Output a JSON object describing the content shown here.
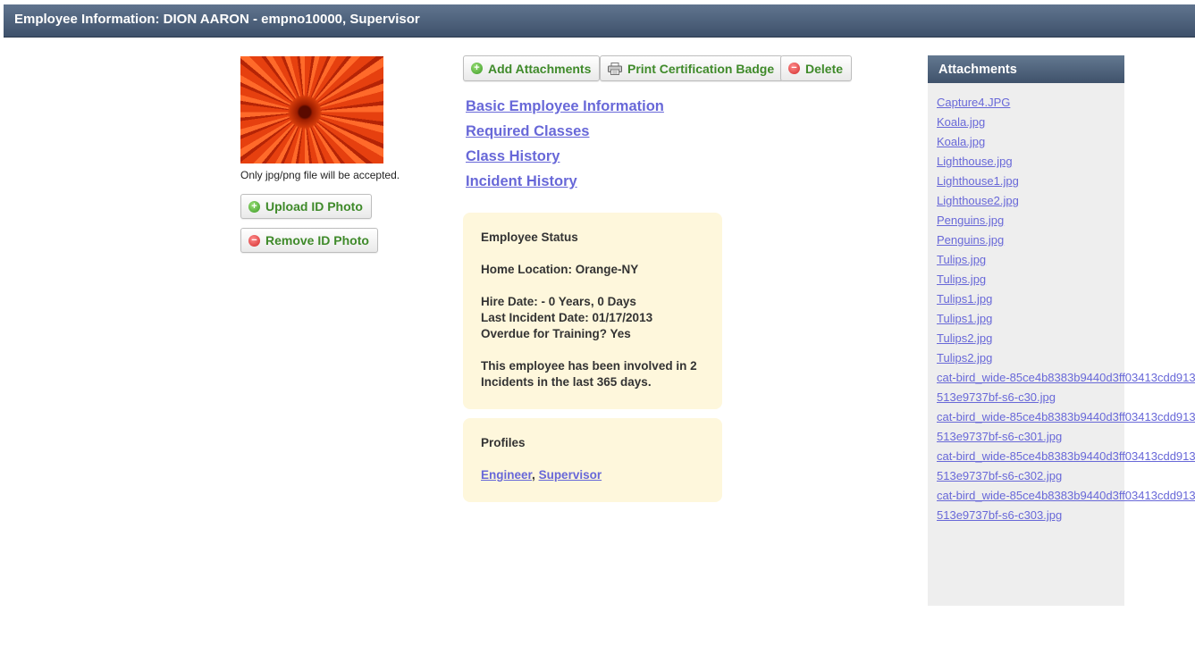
{
  "header": {
    "title": "Employee Information: DION AARON - empno10000, Supervisor"
  },
  "photo": {
    "note": "Only jpg/png file will be accepted."
  },
  "buttons": {
    "upload": "Upload ID Photo",
    "remove": "Remove ID Photo",
    "add_attachments": "Add Attachments",
    "print_badge": "Print Certification Badge",
    "delete": "Delete"
  },
  "nav": [
    "Basic Employee Information",
    "Required Classes",
    "Class History",
    "Incident History"
  ],
  "status": {
    "heading": "Employee Status",
    "home_location": "Home Location: Orange-NY",
    "hire_date": "Hire Date: - 0 Years, 0 Days",
    "last_incident": "Last Incident Date: 01/17/2013",
    "overdue": "Overdue for Training? Yes",
    "incidents_line1": "This employee has been involved in 2",
    "incidents_line2": "Incidents in the last 365 days."
  },
  "profiles": {
    "heading": "Profiles",
    "items": [
      "Engineer",
      "Supervisor"
    ],
    "separator": ","
  },
  "attachments": {
    "title": "Attachments",
    "items": [
      "Capture4.JPG",
      "Koala.jpg",
      "Koala.jpg",
      "Lighthouse.jpg",
      "Lighthouse1.jpg",
      "Lighthouse2.jpg",
      "Penguins.jpg",
      "Penguins.jpg",
      "Tulips.jpg",
      "Tulips.jpg",
      "Tulips1.jpg",
      "Tulips1.jpg",
      "Tulips2.jpg",
      "Tulips2.jpg",
      "cat-bird_wide-85ce4b8383b9440d3ff03413cdd913513e9737bf-s6-c30.jpg",
      "cat-bird_wide-85ce4b8383b9440d3ff03413cdd913513e9737bf-s6-c301.jpg",
      "cat-bird_wide-85ce4b8383b9440d3ff03413cdd913513e9737bf-s6-c302.jpg",
      "cat-bird_wide-85ce4b8383b9440d3ff03413cdd913513e9737bf-s6-c303.jpg"
    ]
  }
}
